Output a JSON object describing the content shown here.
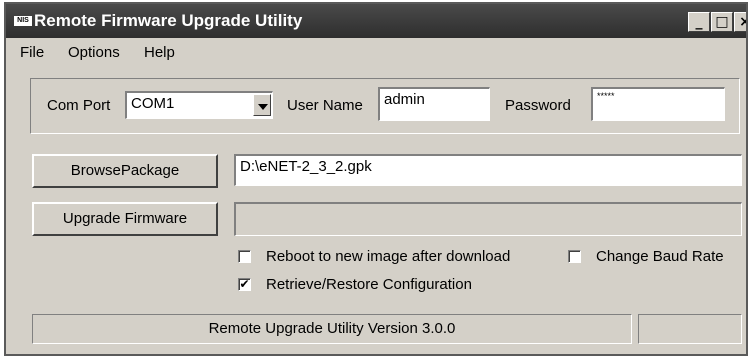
{
  "window": {
    "title": "Remote Firmware Upgrade Utility",
    "icon_text": "NIS",
    "minimize_glyph": "_",
    "maximize_glyph": "□",
    "close_glyph": "×"
  },
  "menu": {
    "file": "File",
    "options": "Options",
    "help": "Help"
  },
  "connection": {
    "com_port_label": "Com Port",
    "com_port_value": "COM1",
    "user_name_label": "User Name",
    "user_name_value": "admin",
    "password_label": "Password",
    "password_value": "*****"
  },
  "package": {
    "browse_label": "BrowsePackage",
    "path": "D:\\eNET-2_3_2.gpk"
  },
  "upgrade": {
    "button_label": "Upgrade Firmware",
    "progress": ""
  },
  "options": {
    "reboot_label": "Reboot to new image after download",
    "reboot_checked": false,
    "baud_label": "Change Baud Rate",
    "baud_checked": false,
    "retrieve_label": "Retrieve/Restore Configuration",
    "retrieve_checked": true,
    "check_glyph": "✔"
  },
  "status": {
    "version": "Remote Upgrade Utility Version 3.0.0",
    "secondary": ""
  }
}
